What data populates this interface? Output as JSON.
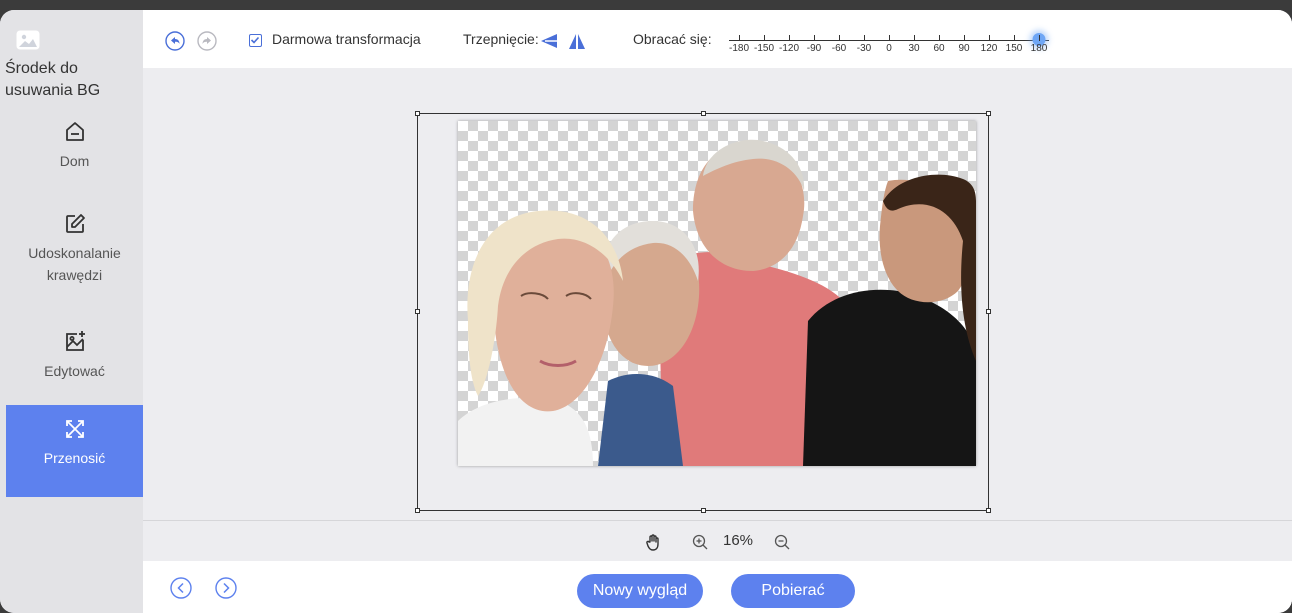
{
  "sidebar": {
    "app_title": "Środek do usuwania BG",
    "items": [
      {
        "id": "home",
        "label": "Dom",
        "icon": "home-icon"
      },
      {
        "id": "edge",
        "label": "Udoskonalanie krawędzi",
        "icon": "edit-square-icon"
      },
      {
        "id": "edit",
        "label": "Edytować",
        "icon": "image-edit-icon"
      },
      {
        "id": "move",
        "label": "Przenosić",
        "icon": "move-arrows-icon",
        "active": true
      }
    ]
  },
  "toolbar": {
    "undo_icon": "undo-icon",
    "redo_icon": "redo-icon",
    "free_transform_label": "Darmowa transformacja",
    "free_transform_checked": true,
    "trim_label": "Trzepnięcie:",
    "flip_icons": [
      "flip-horizontal-icon",
      "flip-vertical-icon"
    ],
    "rotate_label": "Obracać się:",
    "rotate_ticks": [
      "-180",
      "-150",
      "-120",
      "-90",
      "-60",
      "-30",
      "0",
      "30",
      "60",
      "90",
      "120",
      "150",
      "180"
    ],
    "rotate_value": 180
  },
  "canvas": {
    "image_description_icon": "transparent-background-photo"
  },
  "zoom": {
    "hand_icon": "hand-icon",
    "zoom_in_icon": "zoom-in-icon",
    "value": "16%",
    "zoom_out_icon": "zoom-out-icon"
  },
  "footer": {
    "prev_icon": "chevron-left-icon",
    "next_icon": "chevron-right-icon",
    "new_look_label": "Nowy wygląd",
    "download_label": "Pobierać"
  },
  "colors": {
    "accent": "#5d81ee",
    "sidebar_bg": "#e3e3e6",
    "canvas_bg": "#ededf0"
  }
}
